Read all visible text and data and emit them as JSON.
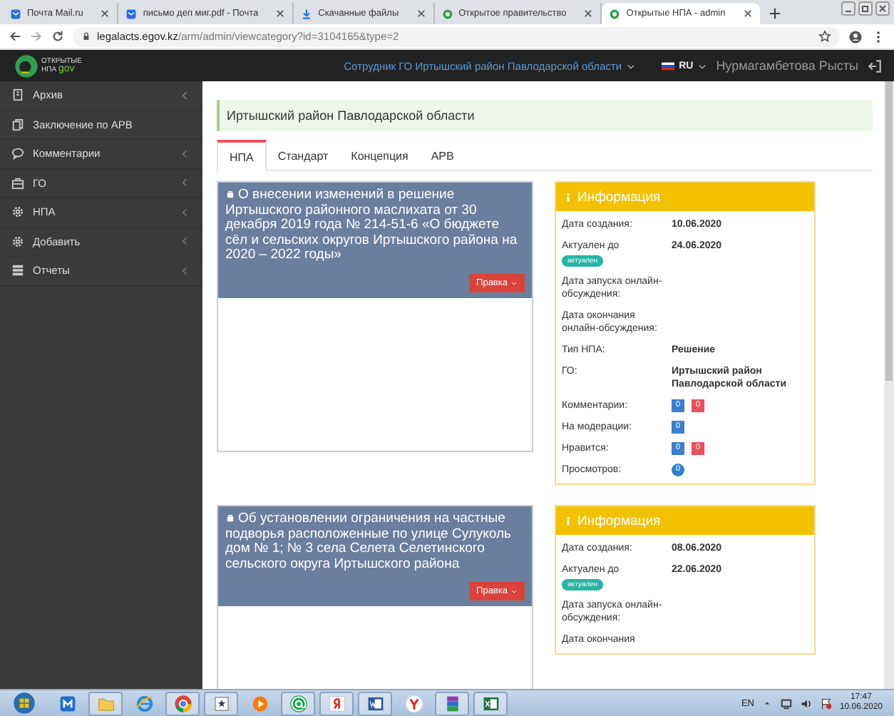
{
  "browser": {
    "tabs": [
      {
        "label": "Почта Mail.ru",
        "selected": false
      },
      {
        "label": "письмо деп миг.pdf - Почта",
        "selected": false
      },
      {
        "label": "Скачанные файлы",
        "selected": false
      },
      {
        "label": "Открытое правительство",
        "selected": false
      },
      {
        "label": "Открытые НПА - admin",
        "selected": true
      }
    ],
    "address_host": "legalacts.egov.kz",
    "address_path": "/arm/admin/viewcategory?id=3104165&type=2"
  },
  "header": {
    "logo_top": "ОТКРЫТЫЕ",
    "logo_bottom": "НПА",
    "logo_gov": "gov",
    "role": "Сотрудник ГО Иртышский район Павлодарской области",
    "language": "RU",
    "user": "Нурмагамбетова Рысты"
  },
  "sidebar": {
    "items": [
      {
        "label": "Архив",
        "has_submenu": true
      },
      {
        "label": "Заключение по АРВ",
        "has_submenu": false
      },
      {
        "label": "Комментарии",
        "has_submenu": true
      },
      {
        "label": "ГО",
        "has_submenu": true
      },
      {
        "label": "НПА",
        "has_submenu": true
      },
      {
        "label": "Добавить",
        "has_submenu": true
      },
      {
        "label": "Отчеты",
        "has_submenu": true
      }
    ]
  },
  "page": {
    "title": "Иртышский район Павлодарской области",
    "tabs": [
      {
        "label": "НПА",
        "selected": true
      },
      {
        "label": "Стандарт",
        "selected": false
      },
      {
        "label": "Концепция",
        "selected": false
      },
      {
        "label": "АРВ",
        "selected": false
      }
    ],
    "acts": [
      {
        "title": "О внесении изменений в решение Иртышского районного маслихата от 30 декабря 2019 года № 214-51-6 «О бюджете сёл и сельских округов Иртышского района на 2020 – 2022 годы»",
        "button": "Правка",
        "info": {
          "title": "Информация",
          "rows": [
            {
              "kind": "text",
              "label": "Дата создания:",
              "value": "10.06.2020"
            },
            {
              "kind": "badge",
              "label": "Актуален до",
              "value": "24.06.2020",
              "badge": "актуален"
            },
            {
              "kind": "text",
              "label": "Дата запуска онлайн-обсуждения:"
            },
            {
              "kind": "text",
              "label": "Дата окончания онлайн-обсуждения:"
            },
            {
              "kind": "text",
              "label": "Тип НПА:",
              "value": "Решение"
            },
            {
              "kind": "text",
              "label": "ГО:",
              "value": "Иртышский район Павлодарской области"
            },
            {
              "kind": "counts",
              "label": "Комментарии:",
              "counts": [
                {
                  "value": "0",
                  "color": "#3a7fd0"
                },
                {
                  "value": "0",
                  "color": "#e8505b"
                }
              ]
            },
            {
              "kind": "counts",
              "label": "На модерации:",
              "counts": [
                {
                  "value": "0",
                  "color": "#3a7fd0"
                }
              ]
            },
            {
              "kind": "counts",
              "label": "Нравится:",
              "counts": [
                {
                  "value": "0",
                  "color": "#3a7fd0"
                },
                {
                  "value": "0",
                  "color": "#e8505b"
                }
              ]
            },
            {
              "kind": "pill",
              "label": "Просмотров:",
              "value": "0"
            }
          ]
        }
      },
      {
        "title": "Об установлении ограничения на частные подворья расположенные по улице Сулуколь дом № 1; № 3 села Селета Селетинского сельского округа Иртышского района",
        "button": "Правка",
        "info": {
          "title": "Информация",
          "rows": [
            {
              "kind": "text",
              "label": "Дата создания:",
              "value": "08.06.2020"
            },
            {
              "kind": "badge",
              "label": "Актуален до",
              "value": "22.06.2020",
              "badge": "актуален"
            },
            {
              "kind": "text",
              "label": "Дата запуска онлайн-обсуждения:"
            },
            {
              "kind": "text",
              "label": "Дата окончания"
            }
          ]
        }
      }
    ]
  },
  "taskbar": {
    "apps": [
      {
        "running": false
      },
      {
        "running": true
      },
      {
        "running": false
      },
      {
        "running": true
      },
      {
        "running": true
      },
      {
        "running": false
      },
      {
        "running": true
      },
      {
        "running": true
      },
      {
        "running": true
      },
      {
        "running": false
      },
      {
        "running": true
      },
      {
        "running": true
      }
    ],
    "language": "EN",
    "time": "17:47",
    "date": "10.06.2020"
  }
}
